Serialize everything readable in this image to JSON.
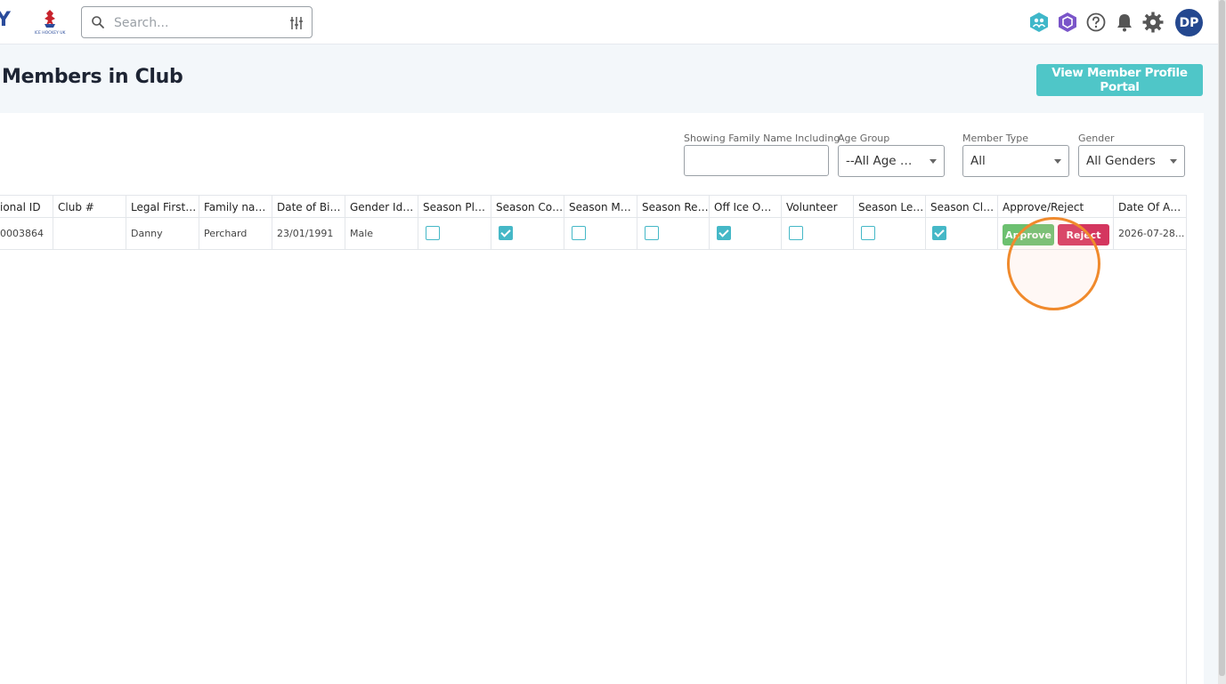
{
  "topbar": {
    "brand_letter": "Y",
    "logo_caption": "ICE HOCKEY UK",
    "search": {
      "placeholder": "Search..."
    },
    "avatar_initials": "DP",
    "icons": [
      "member-hub-icon",
      "club-shield-icon",
      "help-icon",
      "notifications-bell-icon",
      "settings-gear-icon"
    ]
  },
  "header": {
    "title": "Members in Club",
    "portal_button": "View Member Profile Portal"
  },
  "filters": {
    "family_name": {
      "label": "Showing Family Name Including",
      "value": ""
    },
    "age_group": {
      "label": "Age Group",
      "selected": "--All Age Gr..."
    },
    "member_type": {
      "label": "Member Type",
      "selected": "All"
    },
    "gender": {
      "label": "Gender",
      "selected": "All Genders"
    }
  },
  "table": {
    "columns": [
      "ional ID",
      "Club #",
      "Legal Firstn...",
      "Family name",
      "Date of Birth",
      "Gender Iden...",
      "Season Play...",
      "Season Coa...",
      "Season Man...",
      "Season Ref...",
      "Off Ice Offi...",
      "Volunteer",
      "Season Lea...",
      "Season Clu...",
      "Approve/Reject",
      "Date Of App..."
    ],
    "rows": [
      {
        "national_id": "0003864",
        "club_number": "",
        "legal_firstname": "Danny",
        "family_name": "Perchard",
        "date_of_birth": "23/01/1991",
        "gender_identity": "Male",
        "season_player": false,
        "season_coach": true,
        "season_manager": false,
        "season_referee": false,
        "off_ice_official": true,
        "volunteer": false,
        "season_league": false,
        "season_club": true,
        "approve_label": "Approve",
        "reject_label": "Reject",
        "date_of_approval": "2026-07-28..."
      }
    ]
  },
  "colors": {
    "accent": "#4fc6c8",
    "approve": "#6cc070",
    "reject": "#d4365f",
    "checkbox": "#45b8c7",
    "avatar": "#24488f",
    "click_marker": "#f08a2c"
  }
}
